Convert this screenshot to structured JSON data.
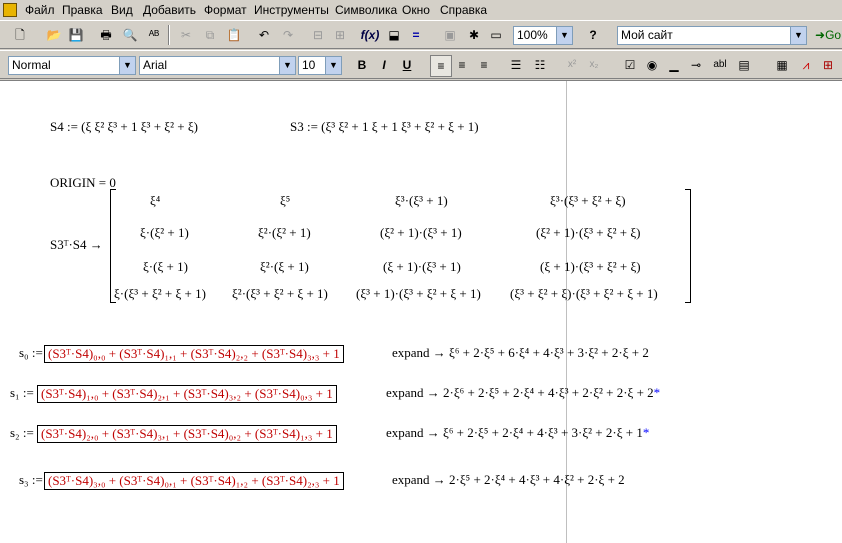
{
  "menu": [
    "Файл",
    "Правка",
    "Вид",
    "Добавить",
    "Формат",
    "Инструменты",
    "Символика",
    "Окно",
    "Справка"
  ],
  "toolbar": {
    "zoom": "100%",
    "site": "Мой сайт",
    "go": "Go",
    "style": "Normal",
    "font": "Arial",
    "size": "10",
    "bold": "B",
    "italic": "I",
    "underline": "U"
  },
  "doc": {
    "s4_def": "S4 := (ξ  ξ² ξ³ + 1  ξ³ + ξ² + ξ)",
    "s3_def": "S3 := (ξ³  ξ² + 1  ξ + 1  ξ³ + ξ² + ξ + 1)",
    "origin": "ORIGIN = 0",
    "product_lhs": "S3ᵀ·S4 →",
    "matrix": [
      [
        "ξ⁴",
        "ξ⁵",
        "ξ³·(ξ³ + 1)",
        "ξ³·(ξ³ + ξ² + ξ)"
      ],
      [
        "ξ·(ξ² + 1)",
        "ξ²·(ξ² + 1)",
        "(ξ² + 1)·(ξ³ + 1)",
        "(ξ² + 1)·(ξ³ + ξ² + ξ)"
      ],
      [
        "ξ·(ξ + 1)",
        "ξ²·(ξ + 1)",
        "(ξ + 1)·(ξ³ + 1)",
        "(ξ + 1)·(ξ³ + ξ² + ξ)"
      ],
      [
        "ξ·(ξ³ + ξ² + ξ + 1)",
        "ξ²·(ξ³ + ξ² + ξ + 1)",
        "(ξ³ + 1)·(ξ³ + ξ² + ξ + 1)",
        "(ξ³ + ξ² + ξ)·(ξ³ + ξ² + ξ + 1)"
      ]
    ],
    "s0_lhs": "s₀ :=",
    "s0_rhs": "(S3ᵀ·S4)₀,₀ + (S3ᵀ·S4)₁,₁ + (S3ᵀ·S4)₂,₂ + (S3ᵀ·S4)₃,₃ + 1",
    "s0_res": "expand  → ξ⁶ + 2·ξ⁵ + 6·ξ⁴ + 4·ξ³ + 3·ξ² + 2·ξ + 2",
    "s1_lhs": "s₁ :=",
    "s1_rhs": "(S3ᵀ·S4)₁,₀ + (S3ᵀ·S4)₂,₁ + (S3ᵀ·S4)₃,₂ + (S3ᵀ·S4)₀,₃ + 1",
    "s1_res": "expand  → 2·ξ⁶ + 2·ξ⁵ + 2·ξ⁴ + 4·ξ³ + 2·ξ² + 2·ξ + 2",
    "s2_lhs": "s₂ :=",
    "s2_rhs": "(S3ᵀ·S4)₂,₀ + (S3ᵀ·S4)₃,₁ + (S3ᵀ·S4)₀,₂ + (S3ᵀ·S4)₁,₃ + 1",
    "s2_res": "expand  → ξ⁶ + 2·ξ⁵ + 2·ξ⁴ + 4·ξ³ + 3·ξ² + 2·ξ + 1",
    "s3_lhs": "s₃ :=",
    "s3_rhs": "(S3ᵀ·S4)₃,₀ + (S3ᵀ·S4)₀,₁ + (S3ᵀ·S4)₁,₂ + (S3ᵀ·S4)₂,₃ + 1",
    "s3_res": "expand  → 2·ξ⁵ + 2·ξ⁴ + 4·ξ³ + 4·ξ² + 2·ξ + 2",
    "star": "*"
  }
}
